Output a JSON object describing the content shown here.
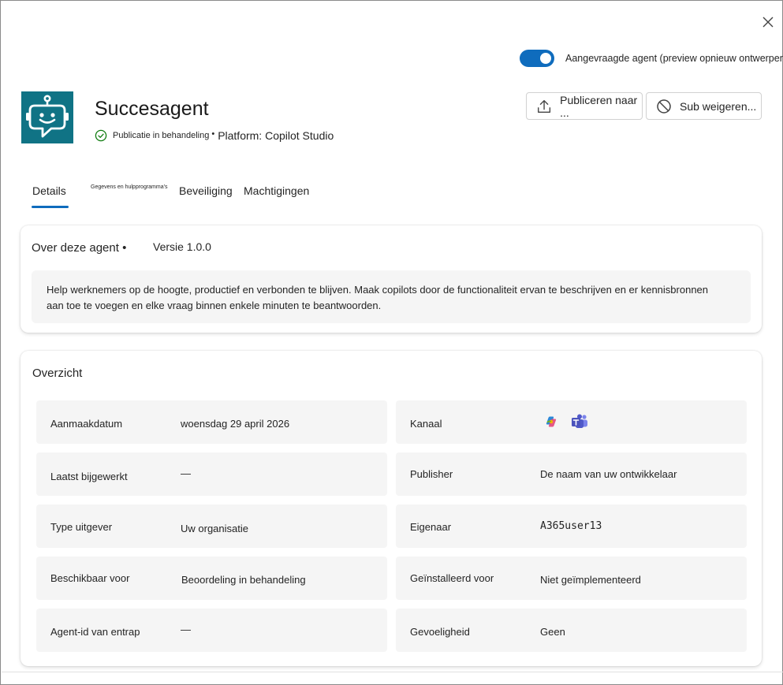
{
  "dialog": {
    "close_icon": "close-icon"
  },
  "toggle": {
    "label": "Aangevraagde agent (preview opnieuw ontwerpen)",
    "state": "on",
    "accent": "#0f6cbd"
  },
  "agent": {
    "name": "Succesagent",
    "logo_icon": "bot-chat-icon",
    "logo_color": "#107385",
    "status_icon": "check-circle-icon",
    "status": "Publicatie in behandeling",
    "separator": "•",
    "platform": "Platform: Copilot Studio"
  },
  "actions": {
    "publish_label": "Publiceren naar ...",
    "publish_icon": "upload-icon",
    "reject_label": "Sub weigeren...",
    "reject_icon": "block-icon"
  },
  "tabs": [
    {
      "label": "Details",
      "active": true
    },
    {
      "label": "Gegevens en hulpprogramma's",
      "active": false
    },
    {
      "label": "Beveiliging",
      "active": false
    },
    {
      "label": "Machtigingen",
      "active": false
    }
  ],
  "about": {
    "title": "Over deze agent •",
    "version": "Versie 1.0.0",
    "description_line1": "Help werknemers op de hoogte, productief en verbonden te blijven. Maak copilots door de functionaliteit ervan te beschrijven en er kennisbronnen",
    "description_line2": "aan toe te voegen en elke vraag binnen enkele minuten te beantwoorden."
  },
  "overview": {
    "title": "Overzicht",
    "left": [
      {
        "label": "Aanmaakdatum",
        "value": "woensdag 29 april 2026"
      },
      {
        "label": "Laatst bijgewerkt",
        "value": "—"
      },
      {
        "label": "Type uitgever",
        "value": "Uw organisatie"
      },
      {
        "label": "Beschikbaar voor",
        "value": "Beoordeling in behandeling"
      },
      {
        "label": "Agent-id van entrap",
        "value": "—"
      }
    ],
    "right": [
      {
        "label": "Kanaal",
        "value": "",
        "icons": [
          "copilot-icon",
          "teams-icon"
        ]
      },
      {
        "label": "Publisher",
        "value": "De naam van uw ontwikkelaar"
      },
      {
        "label": "Eigenaar",
        "value": "A365user13"
      },
      {
        "label": "Geïnstalleerd voor",
        "value": "Niet geïmplementeerd"
      },
      {
        "label": "Gevoeligheid",
        "value": "Geen"
      }
    ]
  }
}
